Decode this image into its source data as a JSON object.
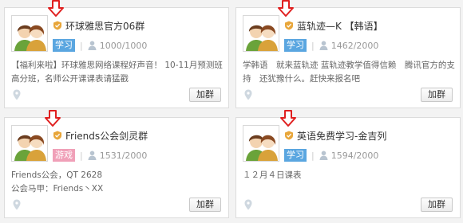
{
  "colors": {
    "tag_study": "#5aa6e0",
    "tag_game": "#f0a0b8",
    "pointer_arrow": "#e02020",
    "verified_badge": "#e8a63a"
  },
  "groups": [
    {
      "title": "环球雅思官方06群",
      "tag": "学习",
      "members": "1000/1000",
      "description": "【福利来啦】环球雅思网络课程好声音！ 10-11月预测班 高分班，名师公开课课表请猛戳",
      "join_label": "加群"
    },
    {
      "title": "蓝轨迹—K 【韩语】",
      "tag": "学习",
      "members": "1462/2000",
      "description": "学韩语　就来蓝轨迹 蓝轨迹教学值得信赖　腾讯官方的支持　还犹豫什么。赶快来报名吧",
      "join_label": "加群"
    },
    {
      "title": "Friends公会剑灵群",
      "tag": "游戏",
      "members": "1531/2000",
      "description": "Friends公会，QT 2628\n公会马甲：Friends丶XX",
      "join_label": "加群"
    },
    {
      "title": "英语免费学习-金吉列",
      "tag": "学习",
      "members": "1594/2000",
      "description": "１２月４日课表",
      "join_label": "加群"
    }
  ]
}
